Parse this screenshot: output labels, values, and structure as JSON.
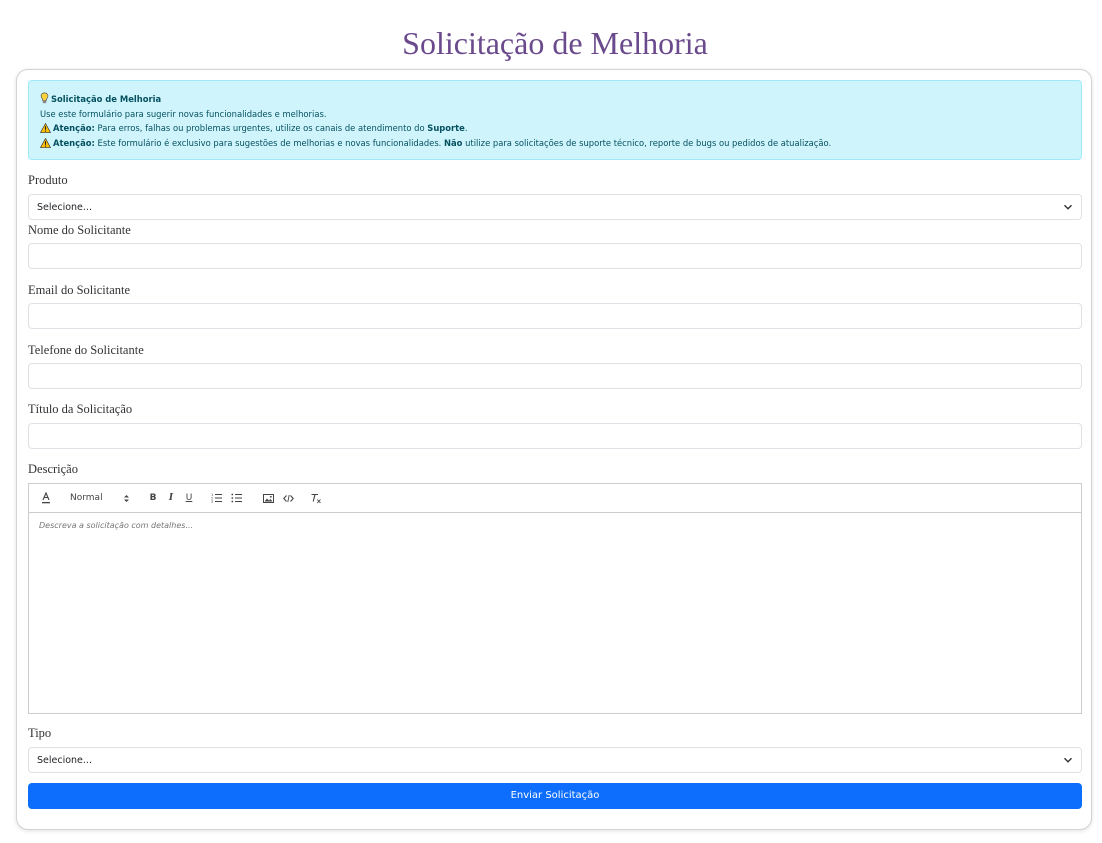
{
  "page": {
    "title": "Solicitação de Melhoria"
  },
  "alert": {
    "heading": "Solicitação de Melhoria",
    "description": "Use este formulário para sugerir novas funcionalidades e melhorias.",
    "warning1": {
      "prefix": "Atenção:",
      "text": " Para erros, falhas ou problemas urgentes, utilize os canais de atendimento do ",
      "strong": "Suporte",
      "suffix": "."
    },
    "warning2": {
      "prefix": "Atenção:",
      "text": " Este formulário é exclusivo para sugestões de melhorias e novas funcionalidades. ",
      "strong": "Não",
      "suffix": " utilize para solicitações de suporte técnico, reporte de bugs ou pedidos de atualização."
    }
  },
  "form": {
    "produto": {
      "label": "Produto",
      "value": "Selecione..."
    },
    "nome": {
      "label": "Nome do Solicitante",
      "value": ""
    },
    "email": {
      "label": "Email do Solicitante",
      "value": ""
    },
    "telefone": {
      "label": "Telefone do Solicitante",
      "value": ""
    },
    "titulo": {
      "label": "Título da Solicitação",
      "value": ""
    },
    "descricao": {
      "label": "Descrição",
      "placeholder": "Descreva a solicitação com detalhes...",
      "toolbar": {
        "header_select": "Normal",
        "bold": "B",
        "italic": "I",
        "underline": "U"
      }
    },
    "tipo": {
      "label": "Tipo",
      "value": "Selecione..."
    },
    "submit_label": "Enviar Solicitação"
  },
  "colors": {
    "title": "#6a4a8c",
    "alert_bg": "#cff4fc",
    "alert_text": "#055160",
    "primary": "#0d6efd"
  },
  "icons": {
    "alert_heading": "lightbulb-icon",
    "warning": "warning-icon",
    "select": "chevron-down-icon"
  }
}
